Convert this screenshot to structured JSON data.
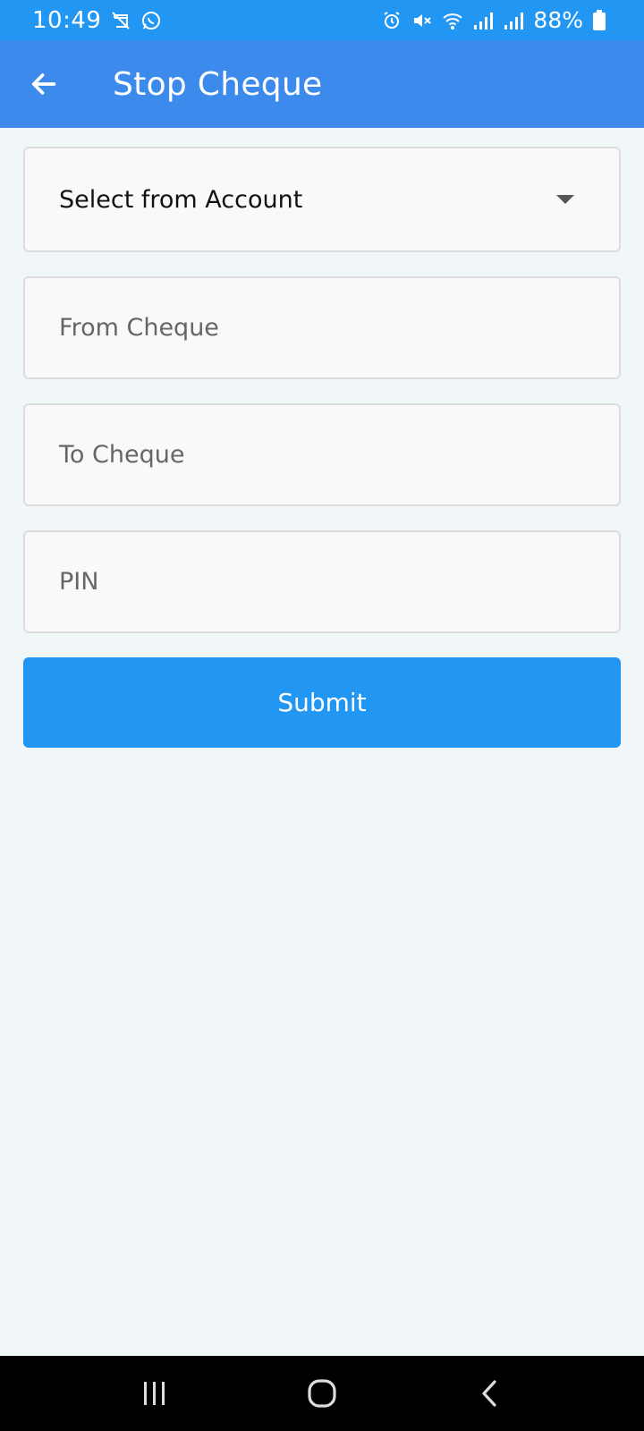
{
  "status_bar": {
    "time": "10:49",
    "battery": "88%",
    "left_icons": [
      "calendar-off-icon",
      "whatsapp-icon"
    ],
    "right_icons": [
      "alarm-icon",
      "mute-icon",
      "wifi-icon",
      "signal-icon",
      "signal-icon",
      "battery-icon"
    ]
  },
  "app_bar": {
    "title": "Stop Cheque",
    "back_icon": "arrow-left-icon"
  },
  "form": {
    "account_select": {
      "value": "Select from Account"
    },
    "from_cheque": {
      "placeholder": "From Cheque"
    },
    "to_cheque": {
      "placeholder": "To Cheque"
    },
    "pin": {
      "placeholder": "PIN"
    },
    "submit_label": "Submit"
  },
  "colors": {
    "status_bar": "#2196f3",
    "app_bar": "#3b8aec",
    "submit": "#2196f3",
    "background": "#f1f6f9"
  },
  "nav_bar": {
    "buttons": [
      "recents-icon",
      "home-icon",
      "back-icon"
    ]
  }
}
